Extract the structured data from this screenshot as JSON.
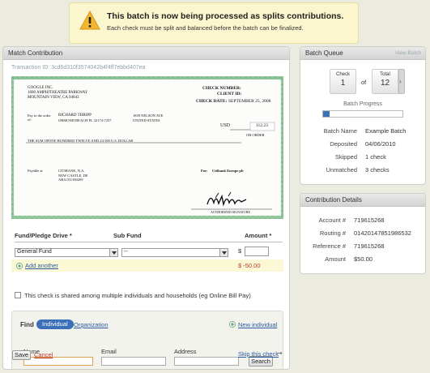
{
  "banner": {
    "title": "This batch is now being processed as splits contributions.",
    "subtitle": "Each check must be split and balanced before the batch can be finalized."
  },
  "match": {
    "header": "Match Contribution",
    "transaction_id": "Transaction ID: 3cd6d310f3574042b4f4ff7ebbd407ea",
    "check": {
      "company_line1": "GOOGLE INC.",
      "company_line2": "1600 AMPHITHEATRE PARKWAY",
      "company_line3": "MOUNTAIN VIEW, CA 94043",
      "check_number_label": "CHECK NUMBER:",
      "client_id_label": "CLIENT ID:",
      "check_date_label": "CHECK DATE:",
      "check_date": "SEPTEMBER 25, 2008",
      "pay_to_label": "Pay to the order of:",
      "payee_name": "RICHARD THRIPP",
      "payee_address": "ORMOND BEACH FL 32174-7237",
      "payee_address2": "1839 NELSON AVE",
      "payee_address3": "UNITED STATES",
      "usd_label": "USD",
      "amount": "112.23",
      "or_order": "OR ORDER",
      "sum_label": "THE SUM OF",
      "sum_text": "ONE HUNDRED TWELVE AND 23/100 U.S. DOLLAR",
      "payable_label": "Payable at",
      "bank_line1": "CITIBANK, N.A.",
      "bank_line2": "NEW CASTLE, DE",
      "bank_line3": "ABA 031100209",
      "for_label": "For:",
      "for_text": "Citibank Europe plc",
      "signature_label": "AUTHORIZED SIGNATURE"
    },
    "fund_header": {
      "fund": "Fund/Pledge Drive *",
      "subfund": "Sub Fund",
      "amount": "Amount *"
    },
    "fund_select": "General Fund",
    "subfund_select": "--",
    "dollar": "$",
    "add_another": "Add another",
    "remaining": "$ -50.00",
    "shared_label": "This check is shared among multiple individuals and households (eg Online Bill Pay)",
    "find": {
      "label": "Find",
      "tab_individual": "Individual",
      "tab_organization": "Organization",
      "new_individual": "New individual",
      "name_label": "Name",
      "email_label": "Email",
      "address_label": "Address",
      "search_button": "Search"
    },
    "save_button": "Save",
    "cancel_link": "Cancel",
    "skip_link": "Skip this check"
  },
  "batch_queue": {
    "header": "Batch Queue",
    "view_link": "View Batch",
    "check_label": "Check",
    "check_value": "1",
    "of": "of",
    "total_label": "Total",
    "total_value": "12",
    "progress_label": "Batch Progress",
    "progress": 0.083,
    "rows": [
      {
        "label": "Batch Name",
        "value": "Example Batch"
      },
      {
        "label": "Deposited",
        "value": "04/06/2010"
      },
      {
        "label": "Skipped",
        "value": "1 check"
      },
      {
        "label": "Unmatched",
        "value": "3 checks"
      }
    ]
  },
  "contribution_details": {
    "header": "Contribution Details",
    "rows": [
      {
        "label": "Account #",
        "value": "719615268"
      },
      {
        "label": "Routing #",
        "value": "014201478519865​32"
      },
      {
        "label": "Reference #",
        "value": "719615268"
      },
      {
        "label": "Amount",
        "value": "$50.00"
      }
    ]
  },
  "colors": {
    "accent_blue": "#2c5aa0",
    "pill_blue": "#3b6fb8",
    "banner_bg": "#fbf6cd",
    "check_green": "#6fb07c",
    "error_red": "#c0392b"
  }
}
